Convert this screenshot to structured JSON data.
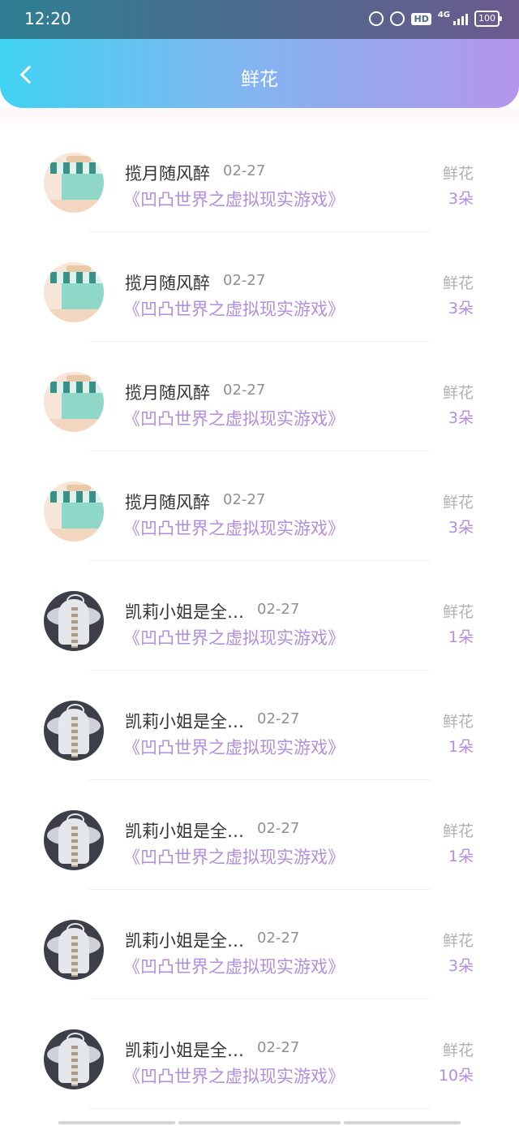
{
  "status_bar": {
    "time": "12:20",
    "hd_label": "HD",
    "network": "4G",
    "battery": "100"
  },
  "header": {
    "title": "鲜花",
    "back_icon": "chevron-left-icon"
  },
  "colors": {
    "gradient_start": "#41d3f2",
    "gradient_end": "#b596ec",
    "book_title": "#b18ede",
    "gift_count": "#b18ede"
  },
  "items": [
    {
      "avatar": "shop",
      "name": "揽月随风醉",
      "date": "02-27",
      "book": "《凹凸世界之虚拟现实游戏》",
      "gift_label": "鲜花",
      "count": "3朵"
    },
    {
      "avatar": "shop",
      "name": "揽月随风醉",
      "date": "02-27",
      "book": "《凹凸世界之虚拟现实游戏》",
      "gift_label": "鲜花",
      "count": "3朵"
    },
    {
      "avatar": "shop",
      "name": "揽月随风醉",
      "date": "02-27",
      "book": "《凹凸世界之虚拟现实游戏》",
      "gift_label": "鲜花",
      "count": "3朵"
    },
    {
      "avatar": "shop",
      "name": "揽月随风醉",
      "date": "02-27",
      "book": "《凹凸世界之虚拟现实游戏》",
      "gift_label": "鲜花",
      "count": "3朵"
    },
    {
      "avatar": "girl",
      "name": "凯莉小姐是全…",
      "date": "02-27",
      "book": "《凹凸世界之虚拟现实游戏》",
      "gift_label": "鲜花",
      "count": "1朵"
    },
    {
      "avatar": "girl",
      "name": "凯莉小姐是全…",
      "date": "02-27",
      "book": "《凹凸世界之虚拟现实游戏》",
      "gift_label": "鲜花",
      "count": "1朵"
    },
    {
      "avatar": "girl",
      "name": "凯莉小姐是全…",
      "date": "02-27",
      "book": "《凹凸世界之虚拟现实游戏》",
      "gift_label": "鲜花",
      "count": "1朵"
    },
    {
      "avatar": "girl",
      "name": "凯莉小姐是全…",
      "date": "02-27",
      "book": "《凹凸世界之虚拟现实游戏》",
      "gift_label": "鲜花",
      "count": "3朵"
    },
    {
      "avatar": "girl",
      "name": "凯莉小姐是全…",
      "date": "02-27",
      "book": "《凹凸世界之虚拟现实游戏》",
      "gift_label": "鲜花",
      "count": "10朵"
    }
  ]
}
